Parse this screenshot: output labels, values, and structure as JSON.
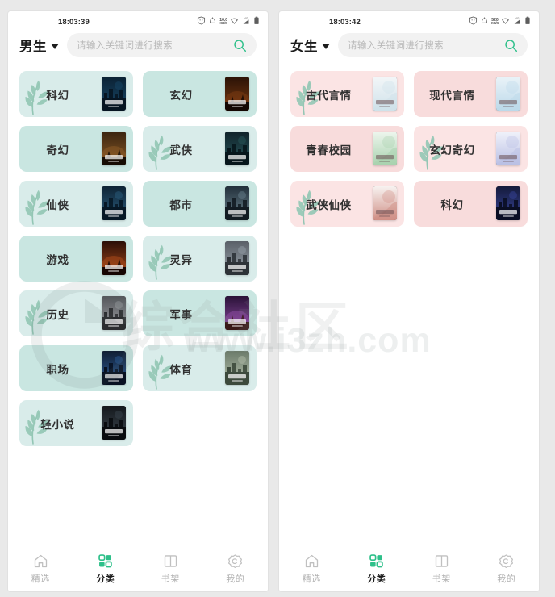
{
  "watermark": {
    "text": "综合社区",
    "url": "www.i3zh.com"
  },
  "panels": [
    {
      "id": "male",
      "theme": {
        "card_bg_a": "#d9ecea",
        "card_bg_b": "#c9e6e1",
        "accent": "#2ec08a"
      },
      "statusbar": {
        "time": "18:03:39",
        "signal": "10.0",
        "signal_sub": "KB/S",
        "net": "4G"
      },
      "header": {
        "gender_label": "男生",
        "caret_icon": "chevron-down-icon",
        "search_placeholder": "请输入关键词进行搜索",
        "search_value": "",
        "search_icon": "search-icon"
      },
      "categories": [
        {
          "label": "科幻",
          "leaf": true,
          "shade": "a",
          "cover": "scifi"
        },
        {
          "label": "玄幻",
          "leaf": false,
          "shade": "b",
          "cover": "xuanhuan"
        },
        {
          "label": "奇幻",
          "leaf": false,
          "shade": "b",
          "cover": "qihuan"
        },
        {
          "label": "武侠",
          "leaf": true,
          "shade": "a",
          "cover": "wuxia"
        },
        {
          "label": "仙侠",
          "leaf": true,
          "shade": "a",
          "cover": "xianxia"
        },
        {
          "label": "都市",
          "leaf": false,
          "shade": "b",
          "cover": "dushi"
        },
        {
          "label": "游戏",
          "leaf": false,
          "shade": "b",
          "cover": "youxi"
        },
        {
          "label": "灵异",
          "leaf": true,
          "shade": "a",
          "cover": "lingyi"
        },
        {
          "label": "历史",
          "leaf": true,
          "shade": "a",
          "cover": "lishi"
        },
        {
          "label": "军事",
          "leaf": false,
          "shade": "b",
          "cover": "junshi"
        },
        {
          "label": "职场",
          "leaf": false,
          "shade": "b",
          "cover": "zhichang"
        },
        {
          "label": "体育",
          "leaf": true,
          "shade": "a",
          "cover": "tiyu"
        },
        {
          "label": "轻小说",
          "leaf": true,
          "shade": "a",
          "cover": "qingxiaoshuo"
        }
      ],
      "tabs": [
        {
          "label": "精选",
          "icon": "home-icon",
          "active": false
        },
        {
          "label": "分类",
          "icon": "grid-icon",
          "active": true
        },
        {
          "label": "书架",
          "icon": "book-icon",
          "active": false
        },
        {
          "label": "我的",
          "icon": "profile-icon",
          "active": false
        }
      ]
    },
    {
      "id": "female",
      "theme": {
        "card_bg_a": "#fbe4e4",
        "card_bg_b": "#f8dcdc",
        "accent": "#2ec08a"
      },
      "statusbar": {
        "time": "18:03:42",
        "signal": "520",
        "signal_sub": "KB/S",
        "net": "4G"
      },
      "header": {
        "gender_label": "女生",
        "caret_icon": "chevron-down-icon",
        "search_placeholder": "请输入关键词进行搜索",
        "search_value": "",
        "search_icon": "search-icon"
      },
      "categories": [
        {
          "label": "古代言情",
          "leaf": true,
          "shade": "a",
          "cover": "gudai"
        },
        {
          "label": "现代言情",
          "leaf": false,
          "shade": "b",
          "cover": "xiandai"
        },
        {
          "label": "青春校园",
          "leaf": false,
          "shade": "b",
          "cover": "qingchun"
        },
        {
          "label": "玄幻奇幻",
          "leaf": true,
          "shade": "a",
          "cover": "xuanqi"
        },
        {
          "label": "武侠仙侠",
          "leaf": true,
          "shade": "a",
          "cover": "wuxian"
        },
        {
          "label": "科幻",
          "leaf": false,
          "shade": "b",
          "cover": "nvkehuan"
        }
      ],
      "tabs": [
        {
          "label": "精选",
          "icon": "home-icon",
          "active": false
        },
        {
          "label": "分类",
          "icon": "grid-icon",
          "active": true
        },
        {
          "label": "书架",
          "icon": "book-icon",
          "active": false
        },
        {
          "label": "我的",
          "icon": "profile-icon",
          "active": false
        }
      ]
    }
  ]
}
